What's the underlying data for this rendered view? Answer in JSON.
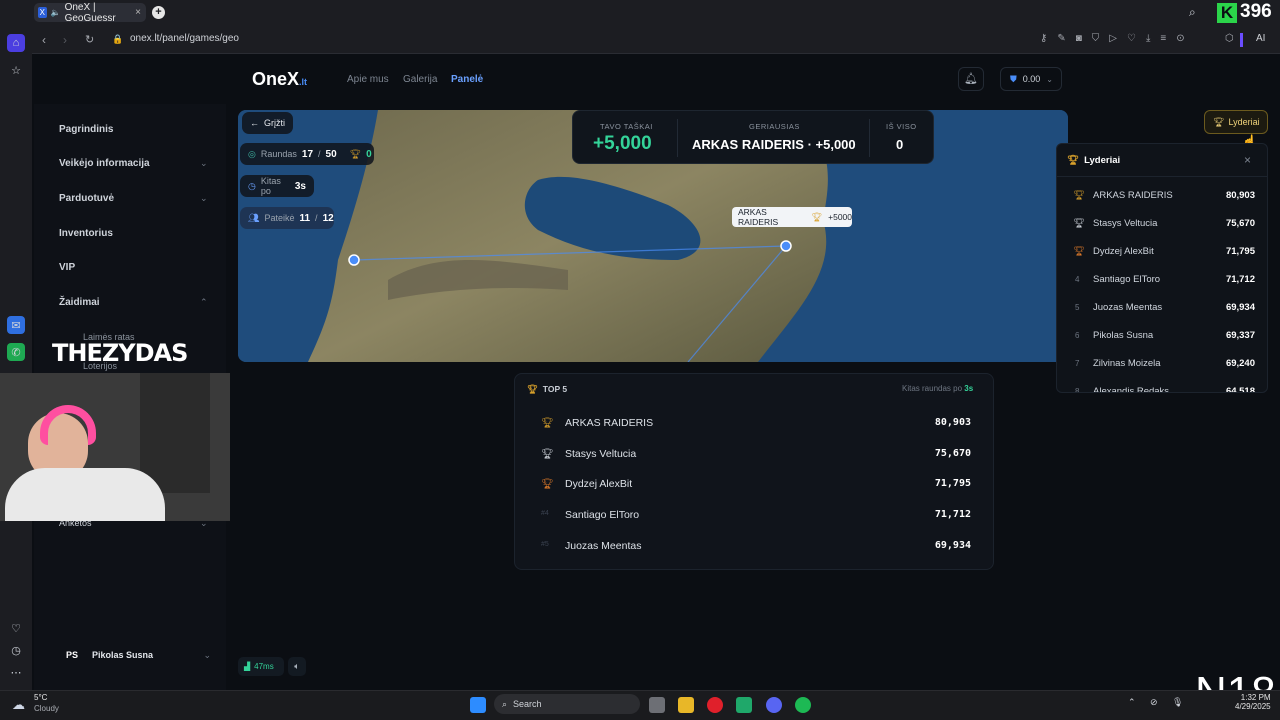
{
  "browser": {
    "tab_title": "OneX | GeoGuessr",
    "url": "onex.lt/panel/games/geo",
    "ai_label": "AI"
  },
  "overlay": {
    "k_badge": "396",
    "streamer_name": "THEZYDAS",
    "corner_tag": "N18"
  },
  "site": {
    "logo": "OneX",
    "logo_suffix": ".lt",
    "nav": [
      "Apie mus",
      "Galerija",
      "Panelė"
    ],
    "balance": "0.00"
  },
  "sidebar": {
    "items": [
      {
        "label": "Pagrindinis"
      },
      {
        "label": "Veikėjo informacija"
      },
      {
        "label": "Parduotuvė"
      },
      {
        "label": "Inventorius"
      },
      {
        "label": "VIP"
      },
      {
        "label": "Žaidimai"
      },
      {
        "label": "Anketos"
      }
    ],
    "sub_items": [
      "Laimės ratas",
      "Loterijos"
    ],
    "user_initials": "PS",
    "user_name": "Pikolas Susna",
    "ping": "47ms"
  },
  "game": {
    "back_label": "Grįžti",
    "round_label": "Raundas",
    "round_value": "17",
    "round_total": "50",
    "trophies": "0",
    "next_label": "Kitas po",
    "next_value": "3s",
    "submitted_label": "Pateikė",
    "submitted_value": "11",
    "submitted_total": "12",
    "your_points_label": "TAVO TAŠKAI",
    "your_points": "+5,000",
    "best_label": "GERIAUSIAS",
    "best_value": "ARKAS RAIDERIS · +5,000",
    "total_label": "IŠ VISO",
    "total_value": "0",
    "marker_name": "ARKAS RAIDERIS",
    "marker_points": "+5000",
    "leaders_button": "Lyderiai"
  },
  "top5": {
    "title": "TOP 5",
    "next_round_label": "Kitas raundas po",
    "next_round_value": "3s",
    "rows": [
      {
        "rank": "1",
        "name": "ARKAS RAIDERIS",
        "score": "80,903"
      },
      {
        "rank": "2",
        "name": "Stasys Veltucia",
        "score": "75,670"
      },
      {
        "rank": "3",
        "name": "Dydzej AlexBit",
        "score": "71,795"
      },
      {
        "rank": "#4",
        "name": "Santiago ElToro",
        "score": "71,712"
      },
      {
        "rank": "#5",
        "name": "Juozas Meentas",
        "score": "69,934"
      }
    ]
  },
  "leaders": {
    "title": "Lyderiai",
    "rows": [
      {
        "rank": "1",
        "name": "ARKAS RAIDERIS",
        "score": "80,903"
      },
      {
        "rank": "2",
        "name": "Stasys Veltucia",
        "score": "75,670"
      },
      {
        "rank": "3",
        "name": "Dydzej AlexBit",
        "score": "71,795"
      },
      {
        "rank": "4",
        "name": "Santiago ElToro",
        "score": "71,712"
      },
      {
        "rank": "5",
        "name": "Juozas Meentas",
        "score": "69,934"
      },
      {
        "rank": "6",
        "name": "Pikolas Susna",
        "score": "69,337"
      },
      {
        "rank": "7",
        "name": "Zilvinas Moizela",
        "score": "69,240"
      },
      {
        "rank": "8",
        "name": "Alexandis Redaks",
        "score": "64,518"
      }
    ]
  },
  "taskbar": {
    "weather_temp": "5°C",
    "weather_desc": "Cloudy",
    "search_placeholder": "Search",
    "time": "1:32 PM",
    "date": "4/29/2025"
  }
}
